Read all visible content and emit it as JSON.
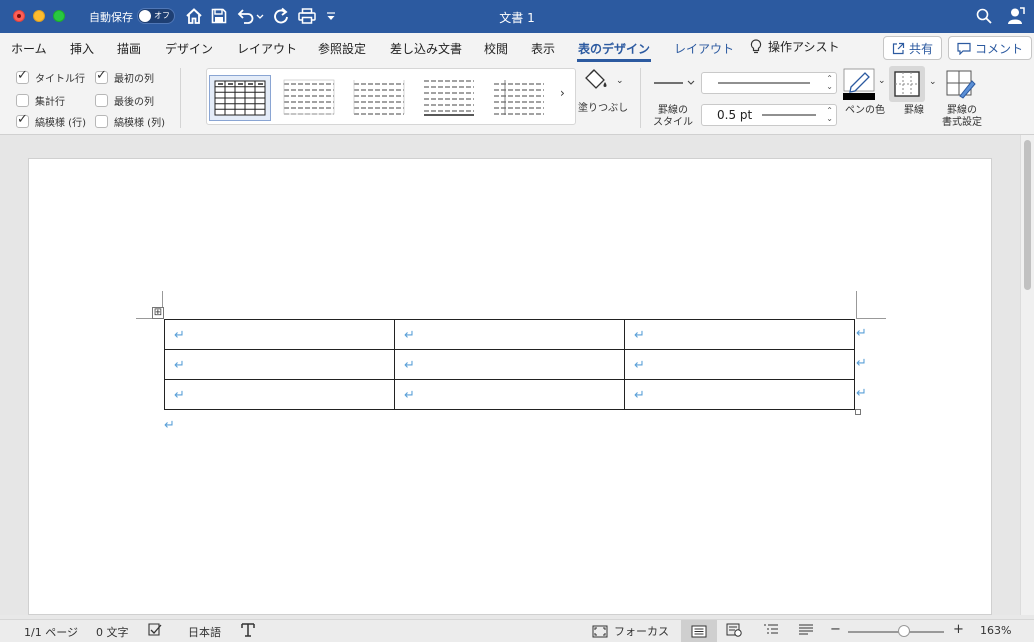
{
  "titlebar": {
    "autosave_label": "自動保存",
    "autosave_state": "オフ",
    "document_title": "文書 1"
  },
  "tabs": {
    "items": [
      "ホーム",
      "挿入",
      "描画",
      "デザイン",
      "レイアウト",
      "参照設定",
      "差し込み文書",
      "校閲",
      "表示",
      "表のデザイン",
      "レイアウト"
    ],
    "active": "表のデザイン",
    "assist": "操作アシスト",
    "share": "共有",
    "comment": "コメント"
  },
  "ribbon": {
    "options": {
      "title_row": "タイトル行",
      "total_row": "集計行",
      "banded_rows": "縞模様 (行)",
      "first_column": "最初の列",
      "last_column": "最後の列",
      "banded_columns": "縞模様 (列)"
    },
    "shading": "塗りつぶし",
    "border_style_line1": "罫線の",
    "border_style_line2": "スタイル",
    "pen_weight": "0.5 pt",
    "pen_color": "ペンの色",
    "borders": "罫線",
    "border_format_line1": "罫線の",
    "border_format_line2": "書式設定",
    "pen_color_value": "#000000"
  },
  "document": {
    "paragraph_mark": "↵",
    "table_move_handle": "⊞"
  },
  "status": {
    "page": "1/1 ページ",
    "words": "0 文字",
    "language": "日本語",
    "focus": "フォーカス",
    "zoom": "163%",
    "zoom_minus": "−",
    "zoom_plus": "+"
  },
  "colors": {
    "title_bar": "#2c5aa0",
    "accent": "#2c5aa0",
    "paragraph_mark": "#5aa0d8"
  }
}
